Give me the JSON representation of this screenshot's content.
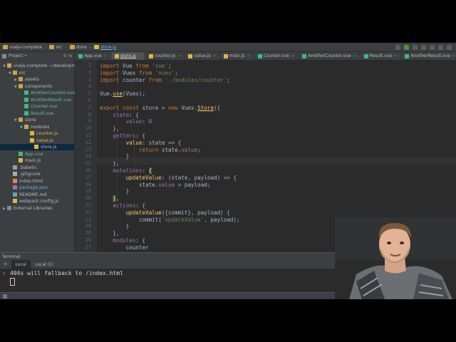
{
  "nav": {
    "breadcrumbs": [
      "vuejs-complete",
      "src",
      "store",
      "store.js"
    ]
  },
  "project_panel": {
    "label": "Project"
  },
  "tabs": [
    {
      "label": "App.vue",
      "type": "vue"
    },
    {
      "label": "store.js",
      "type": "js",
      "active": true
    },
    {
      "label": "counter.js",
      "type": "js"
    },
    {
      "label": "value.js",
      "type": "js"
    },
    {
      "label": "main.js",
      "type": "js"
    },
    {
      "label": "Counter.vue",
      "type": "vue"
    },
    {
      "label": "AnotherCounter.vue",
      "type": "vue"
    },
    {
      "label": "Result.vue",
      "type": "vue"
    },
    {
      "label": "AnotherResult.vue",
      "type": "vue"
    }
  ],
  "tree": [
    {
      "label": "vuejs-complete ~/developm",
      "depth": 0,
      "type": "folder",
      "expanded": true
    },
    {
      "label": "src",
      "depth": 1,
      "type": "folder",
      "expanded": true
    },
    {
      "label": "assets",
      "depth": 2,
      "type": "folder",
      "expanded": false
    },
    {
      "label": "components",
      "depth": 2,
      "type": "folder",
      "expanded": true
    },
    {
      "label": "AnotherCounter.vue",
      "depth": 3,
      "type": "vue"
    },
    {
      "label": "AnotherResult.vue",
      "depth": 3,
      "type": "vue"
    },
    {
      "label": "Counter.vue",
      "depth": 3,
      "type": "vue"
    },
    {
      "label": "Result.vue",
      "depth": 3,
      "type": "vue"
    },
    {
      "label": "store",
      "depth": 2,
      "type": "folder",
      "expanded": true
    },
    {
      "label": "modules",
      "depth": 3,
      "type": "folder",
      "expanded": true
    },
    {
      "label": "counter.js",
      "depth": 4,
      "type": "js"
    },
    {
      "label": "value.js",
      "depth": 4,
      "type": "js"
    },
    {
      "label": "store.js",
      "depth": 3,
      "type": "js",
      "selected": true
    },
    {
      "label": "App.vue",
      "depth": 2,
      "type": "vue"
    },
    {
      "label": "main.js",
      "depth": 2,
      "type": "js"
    },
    {
      "label": ".babelrc",
      "depth": 1,
      "type": "config"
    },
    {
      "label": ".gitignore",
      "depth": 1,
      "type": "text"
    },
    {
      "label": "index.html",
      "depth": 1,
      "type": "html"
    },
    {
      "label": "package.json",
      "depth": 1,
      "type": "json"
    },
    {
      "label": "README.md",
      "depth": 1,
      "type": "md"
    },
    {
      "label": "webpack.config.js",
      "depth": 1,
      "type": "js"
    },
    {
      "label": "External Libraries",
      "depth": 0,
      "type": "lib"
    }
  ],
  "code": [
    {
      "line": "1",
      "tokens": [
        [
          "kw",
          "import "
        ],
        [
          "plain",
          "Vue "
        ],
        [
          "kw",
          "from "
        ],
        [
          "str",
          "'vue'"
        ],
        [
          "plain",
          ";"
        ]
      ]
    },
    {
      "line": "2",
      "tokens": [
        [
          "kw",
          "import "
        ],
        [
          "plain",
          "Vuex "
        ],
        [
          "kw",
          "from "
        ],
        [
          "str",
          "'vuex'"
        ],
        [
          "plain",
          ";"
        ]
      ]
    },
    {
      "line": "3",
      "tokens": [
        [
          "kw",
          "import "
        ],
        [
          "plain",
          "counter "
        ],
        [
          "kw",
          "from "
        ],
        [
          "str",
          "'./modules/counter'"
        ],
        [
          "plain",
          ";"
        ]
      ]
    },
    {
      "line": "4",
      "tokens": []
    },
    {
      "line": "5",
      "tokens": [
        [
          "plain",
          "Vue."
        ],
        [
          "fn-u",
          "use"
        ],
        [
          "plain",
          "(Vuex);"
        ]
      ]
    },
    {
      "line": "6",
      "tokens": []
    },
    {
      "line": "7",
      "tokens": [
        [
          "kw",
          "export const "
        ],
        [
          "plain",
          "store = "
        ],
        [
          "kw",
          "new "
        ],
        [
          "plain",
          "Vuex."
        ],
        [
          "fn-u",
          "Store"
        ],
        [
          "plain",
          "({"
        ]
      ]
    },
    {
      "line": "8",
      "tokens": [
        [
          "plain",
          "    "
        ],
        [
          "prop",
          "state"
        ],
        [
          "plain",
          ": {"
        ]
      ]
    },
    {
      "line": "9",
      "tokens": [
        [
          "plain",
          "        "
        ],
        [
          "prop",
          "value"
        ],
        [
          "plain",
          ": "
        ],
        [
          "num",
          "0"
        ]
      ]
    },
    {
      "line": "10",
      "tokens": [
        [
          "plain",
          "    },"
        ]
      ]
    },
    {
      "line": "11",
      "tokens": [
        [
          "plain",
          "    "
        ],
        [
          "prop",
          "getters"
        ],
        [
          "plain",
          ": {"
        ]
      ]
    },
    {
      "line": "12",
      "tokens": [
        [
          "plain",
          "        "
        ],
        [
          "fn",
          "value"
        ],
        [
          "plain",
          ": state => {"
        ]
      ]
    },
    {
      "line": "13",
      "tokens": [
        [
          "plain",
          "            "
        ],
        [
          "kw",
          "return "
        ],
        [
          "plain",
          "state."
        ],
        [
          "prop",
          "value"
        ],
        [
          "plain",
          ";"
        ]
      ]
    },
    {
      "line": "14",
      "tokens": [
        [
          "plain",
          "        }"
        ]
      ]
    },
    {
      "line": "15",
      "tokens": [
        [
          "plain",
          "    },"
        ]
      ]
    },
    {
      "line": "16",
      "tokens": [
        [
          "plain",
          "    "
        ],
        [
          "prop",
          "mutations"
        ],
        [
          "plain",
          ": "
        ],
        [
          "hl",
          "{"
        ]
      ]
    },
    {
      "line": "17",
      "tokens": [
        [
          "plain",
          "        "
        ],
        [
          "fn",
          "updateValue"
        ],
        [
          "plain",
          ": (state, payload) => {"
        ]
      ]
    },
    {
      "line": "18",
      "tokens": [
        [
          "plain",
          "            state."
        ],
        [
          "prop",
          "value"
        ],
        [
          "plain",
          " = payload;"
        ]
      ]
    },
    {
      "line": "19",
      "tokens": [
        [
          "plain",
          "        }"
        ]
      ]
    },
    {
      "line": "20",
      "tokens": [
        [
          "plain",
          "    "
        ],
        [
          "hl",
          "}"
        ],
        [
          "plain",
          ","
        ]
      ]
    },
    {
      "line": "21",
      "tokens": [
        [
          "plain",
          "    "
        ],
        [
          "prop",
          "actions"
        ],
        [
          "plain",
          ": {"
        ]
      ]
    },
    {
      "line": "22",
      "tokens": [
        [
          "plain",
          "        "
        ],
        [
          "fn",
          "updateValue"
        ],
        [
          "plain",
          "({commit}, payload) {"
        ]
      ]
    },
    {
      "line": "23",
      "tokens": [
        [
          "plain",
          "            commit("
        ],
        [
          "str",
          "'updateValue'"
        ],
        [
          "plain",
          ", payload);"
        ]
      ]
    },
    {
      "line": "24",
      "tokens": [
        [
          "plain",
          "        }"
        ]
      ]
    },
    {
      "line": "25",
      "tokens": [
        [
          "plain",
          "    },"
        ]
      ]
    },
    {
      "line": "26",
      "tokens": [
        [
          "plain",
          "    "
        ],
        [
          "prop",
          "modules"
        ],
        [
          "plain",
          ": {"
        ]
      ]
    },
    {
      "line": "27",
      "tokens": [
        [
          "plain",
          "        counter"
        ]
      ]
    },
    {
      "line": "28",
      "tokens": [
        [
          "plain",
          "    }"
        ]
      ]
    }
  ],
  "terminal": {
    "title": "Terminal",
    "tabs": [
      "Local",
      "Local (1)"
    ],
    "output": "404s will fallback to /index.html"
  },
  "colors": {
    "vue": "#41b883",
    "js": "#d9b84a",
    "folder": "#c9a44a",
    "json": "#9876aa",
    "html": "#e8824a"
  }
}
